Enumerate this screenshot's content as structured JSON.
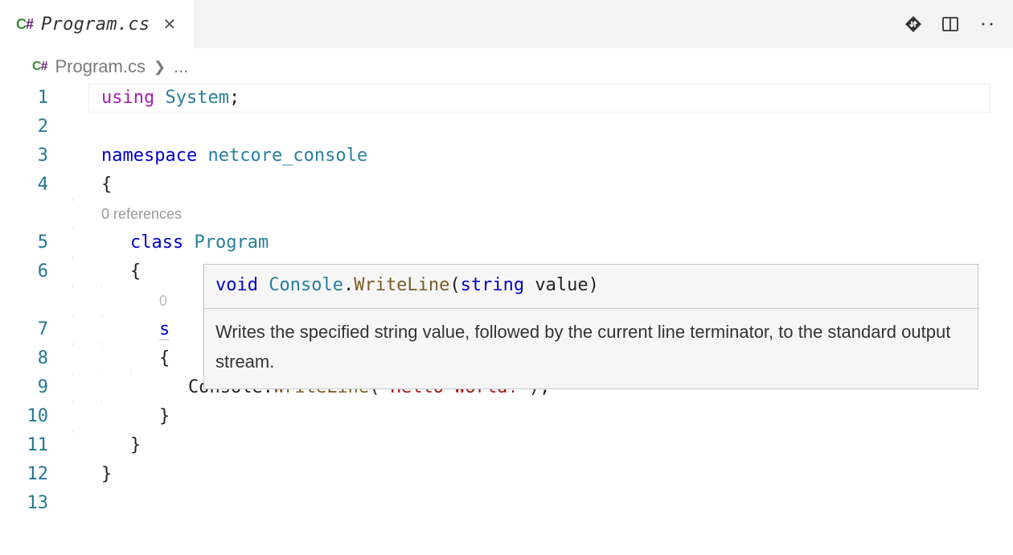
{
  "tab": {
    "file_name": "Program.cs",
    "language_badge": {
      "c": "C",
      "sharp": "#"
    }
  },
  "breadcrumb": {
    "file_name": "Program.cs",
    "overflow": "..."
  },
  "gutters": [
    "1",
    "2",
    "3",
    "4",
    "",
    "5",
    "6",
    "",
    "7",
    "8",
    "9",
    "10",
    "11",
    "12",
    "13"
  ],
  "code": {
    "l1": {
      "using": "using",
      "space": " ",
      "system": "System",
      "semi": ";"
    },
    "l3": {
      "namespace": "namespace",
      "space": " ",
      "ns": "netcore_console"
    },
    "l4": {
      "brace": "{"
    },
    "codelens1": "0 references",
    "l5": {
      "class_kw": "class",
      "space": " ",
      "class_name": "Program"
    },
    "l6": {
      "brace": "{"
    },
    "codelens2_frag": "0",
    "l7": {
      "frag": "s"
    },
    "l8": {
      "frag": "{"
    },
    "l9": {
      "console_txt": "Console",
      "dot": ".",
      "fn": "WriteLine",
      "open": "(",
      "str": "\"Hello World!\"",
      "close_semi": ");"
    },
    "l10": {
      "brace": "}"
    },
    "l11": {
      "brace": "}"
    },
    "l12": {
      "brace": "}"
    }
  },
  "hover": {
    "sig": {
      "void_kw": "void",
      "sp1": " ",
      "console": "Console",
      "dot": ".",
      "fn": "WriteLine",
      "open": "(",
      "param_t": "string",
      "sp2": " ",
      "param_n": "value",
      "close": ")"
    },
    "doc": "Writes the specified string value, followed by the current line terminator, to the standard output stream."
  }
}
